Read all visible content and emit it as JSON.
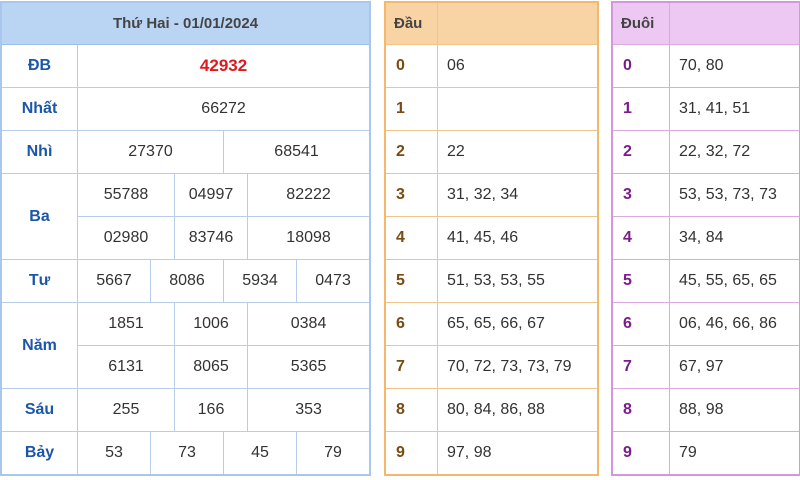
{
  "results": {
    "title": "Thứ Hai - 01/01/2024",
    "db": {
      "label": "ĐB",
      "values": [
        "42932"
      ]
    },
    "nhat": {
      "label": "Nhất",
      "values": [
        "66272"
      ]
    },
    "nhi": {
      "label": "Nhì",
      "values": [
        "27370",
        "68541"
      ]
    },
    "ba": {
      "label": "Ba",
      "values": [
        "55788",
        "04997",
        "82222",
        "02980",
        "83746",
        "18098"
      ]
    },
    "tu": {
      "label": "Tư",
      "values": [
        "5667",
        "8086",
        "5934",
        "0473"
      ]
    },
    "nam": {
      "label": "Năm",
      "values": [
        "1851",
        "1006",
        "0384",
        "6131",
        "8065",
        "5365"
      ]
    },
    "sau": {
      "label": "Sáu",
      "values": [
        "255",
        "166",
        "353"
      ]
    },
    "bay": {
      "label": "Bảy",
      "values": [
        "53",
        "73",
        "45",
        "79"
      ]
    }
  },
  "dau": {
    "header": "Đầu",
    "rows": [
      {
        "k": "0",
        "v": "06"
      },
      {
        "k": "1",
        "v": ""
      },
      {
        "k": "2",
        "v": "22"
      },
      {
        "k": "3",
        "v": "31, 32, 34"
      },
      {
        "k": "4",
        "v": "41, 45, 46"
      },
      {
        "k": "5",
        "v": "51, 53, 53, 55"
      },
      {
        "k": "6",
        "v": "65, 65, 66, 67"
      },
      {
        "k": "7",
        "v": "70, 72, 73, 73, 79"
      },
      {
        "k": "8",
        "v": "80, 84, 86, 88"
      },
      {
        "k": "9",
        "v": "97, 98"
      }
    ]
  },
  "duoi": {
    "header": "Đuôi",
    "rows": [
      {
        "k": "0",
        "v": "70, 80"
      },
      {
        "k": "1",
        "v": "31, 41, 51"
      },
      {
        "k": "2",
        "v": "22, 32, 72"
      },
      {
        "k": "3",
        "v": "53, 53, 73, 73"
      },
      {
        "k": "4",
        "v": "34, 84"
      },
      {
        "k": "5",
        "v": "45, 55, 65, 65"
      },
      {
        "k": "6",
        "v": "06, 46, 66, 86"
      },
      {
        "k": "7",
        "v": "67, 97"
      },
      {
        "k": "8",
        "v": "88, 98"
      },
      {
        "k": "9",
        "v": "79"
      }
    ]
  },
  "colors": {
    "results_header": "#b9d5f3",
    "dau_header": "#f8d3a3",
    "duoi_header": "#edc8f2",
    "special_prize": "#e0191f",
    "label_blue": "#1c56a8"
  }
}
